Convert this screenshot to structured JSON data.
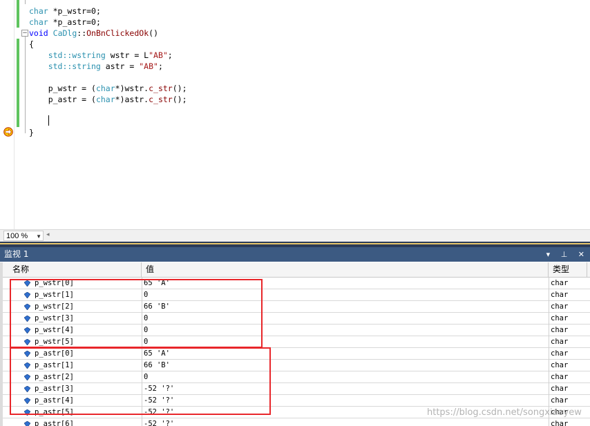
{
  "editor": {
    "lines": [
      {
        "parts": [
          {
            "t": "char",
            "c": "tp"
          },
          {
            "t": " *p_wstr=0;",
            "c": ""
          }
        ]
      },
      {
        "parts": [
          {
            "t": "char",
            "c": "tp"
          },
          {
            "t": " *p_astr=0;",
            "c": ""
          }
        ]
      },
      {
        "parts": [
          {
            "t": "void",
            "c": "kw"
          },
          {
            "t": " ",
            "c": ""
          },
          {
            "t": "CaDlg",
            "c": "tp"
          },
          {
            "t": "::",
            "c": ""
          },
          {
            "t": "OnBnClickedOk",
            "c": "fn"
          },
          {
            "t": "()",
            "c": ""
          }
        ]
      },
      {
        "parts": [
          {
            "t": "{",
            "c": ""
          }
        ]
      },
      {
        "parts": [
          {
            "t": "    std::wstring",
            "c": "tp"
          },
          {
            "t": " wstr = L",
            "c": ""
          },
          {
            "t": "\"AB\"",
            "c": "st"
          },
          {
            "t": ";",
            "c": ""
          }
        ]
      },
      {
        "parts": [
          {
            "t": "    std::string",
            "c": "tp"
          },
          {
            "t": " astr = ",
            "c": ""
          },
          {
            "t": "\"AB\"",
            "c": "st"
          },
          {
            "t": ";",
            "c": ""
          }
        ]
      },
      {
        "parts": [
          {
            "t": "",
            "c": ""
          }
        ]
      },
      {
        "parts": [
          {
            "t": "    p_wstr = (",
            "c": ""
          },
          {
            "t": "char",
            "c": "tp"
          },
          {
            "t": "*)wstr.",
            "c": ""
          },
          {
            "t": "c_str",
            "c": "fn"
          },
          {
            "t": "();",
            "c": ""
          }
        ]
      },
      {
        "parts": [
          {
            "t": "    p_astr = (",
            "c": ""
          },
          {
            "t": "char",
            "c": "tp"
          },
          {
            "t": "*)astr.",
            "c": ""
          },
          {
            "t": "c_str",
            "c": "fn"
          },
          {
            "t": "();",
            "c": ""
          }
        ]
      },
      {
        "parts": [
          {
            "t": "",
            "c": ""
          }
        ]
      },
      {
        "parts": [
          {
            "t": "",
            "c": ""
          }
        ]
      },
      {
        "parts": [
          {
            "t": "}",
            "c": ""
          }
        ]
      }
    ],
    "zoom": "100 %",
    "collapse_symbol": "−"
  },
  "watch": {
    "title": "监视 1",
    "buttons": "▾ ⊥ ✕",
    "columns": {
      "name": "名称",
      "value": "值",
      "type": "类型"
    },
    "rows": [
      {
        "name": "p_wstr[0]",
        "value": "65 'A'",
        "type": "char"
      },
      {
        "name": "p_wstr[1]",
        "value": "0",
        "type": "char"
      },
      {
        "name": "p_wstr[2]",
        "value": "66 'B'",
        "type": "char"
      },
      {
        "name": "p_wstr[3]",
        "value": "0",
        "type": "char"
      },
      {
        "name": "p_wstr[4]",
        "value": "0",
        "type": "char"
      },
      {
        "name": "p_wstr[5]",
        "value": "0",
        "type": "char"
      },
      {
        "name": "p_astr[0]",
        "value": "65 'A'",
        "type": "char"
      },
      {
        "name": "p_astr[1]",
        "value": "66 'B'",
        "type": "char"
      },
      {
        "name": "p_astr[2]",
        "value": "0",
        "type": "char"
      },
      {
        "name": "p_astr[3]",
        "value": "-52 '?'",
        "type": "char"
      },
      {
        "name": "p_astr[4]",
        "value": "-52 '?'",
        "type": "char"
      },
      {
        "name": "p_astr[5]",
        "value": "-52 '?'",
        "type": "char"
      },
      {
        "name": "p_astr[6]",
        "value": "-52 '?'",
        "type": "char"
      }
    ]
  },
  "watermark": "https://blog.csdn.net/songxiaoyew",
  "colors": {
    "highlight_box": "#e8262a",
    "title_bar": "#3c5a82",
    "change_bar": "#5fc45f"
  }
}
